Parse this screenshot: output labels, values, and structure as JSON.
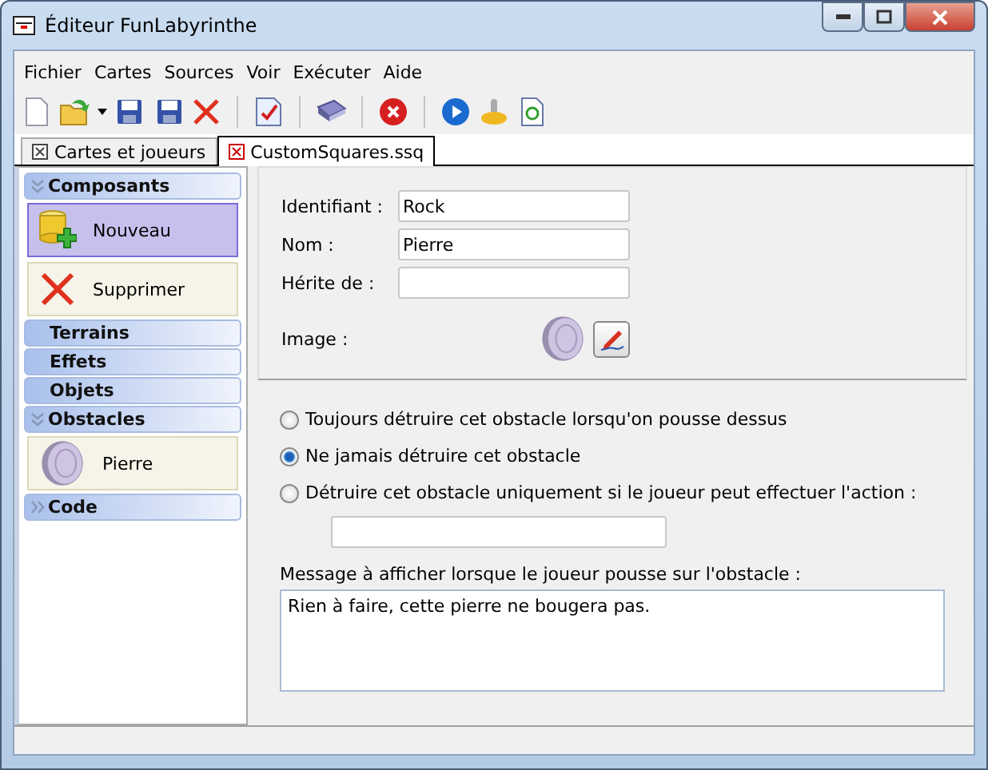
{
  "window": {
    "title": "Éditeur FunLabyrinthe"
  },
  "menu": [
    "Fichier",
    "Cartes",
    "Sources",
    "Voir",
    "Exécuter",
    "Aide"
  ],
  "tabs": [
    {
      "label": "Cartes et joueurs",
      "selected": false
    },
    {
      "label": "CustomSquares.ssq",
      "selected": true
    }
  ],
  "sidebar": {
    "groups": [
      {
        "title": "Composants",
        "expanded": true,
        "items": [
          {
            "label": "Nouveau",
            "kind": "new",
            "selected": true
          },
          {
            "label": "Supprimer",
            "kind": "delete",
            "selected": false
          }
        ]
      },
      {
        "title": "Terrains"
      },
      {
        "title": "Effets"
      },
      {
        "title": "Objets"
      },
      {
        "title": "Obstacles",
        "expanded": true,
        "items": [
          {
            "label": "Pierre",
            "kind": "stone",
            "selected": false
          }
        ]
      },
      {
        "title": "Code",
        "expanded": false
      }
    ]
  },
  "form": {
    "fields": [
      {
        "label": "Identifiant :",
        "value": "Rock"
      },
      {
        "label": "Nom :",
        "value": "Pierre"
      },
      {
        "label": "Hérite de :"
      }
    ],
    "image_label": "Image :"
  },
  "options": [
    {
      "label": "Toujours détruire cet obstacle lorsqu'on pousse dessus",
      "selected": false
    },
    {
      "label": "Ne jamais détruire cet obstacle",
      "selected": true
    },
    {
      "label": "Détruire cet obstacle uniquement si le joueur peut effectuer l'action :",
      "selected": false
    }
  ],
  "message": {
    "label": "Message à afficher lorsque le joueur pousse sur l'obstacle :",
    "value": "Rien à faire, cette pierre ne bougera pas."
  }
}
